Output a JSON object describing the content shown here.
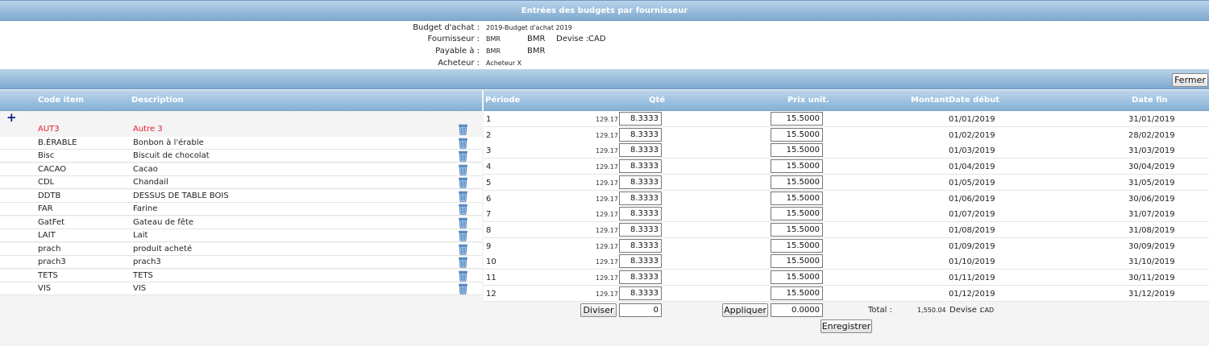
{
  "title": "Entrées des budgets par fournisseur",
  "header": {
    "budget_label": "Budget d'achat :",
    "budget_value": "2019-Budget d'achat 2019",
    "fournisseur_label": "Fournisseur :",
    "fournisseur_code": "BMR",
    "fournisseur_name": "BMR",
    "devise_label": "Devise :",
    "devise_value": "CAD",
    "payable_label": "Payable à :",
    "payable_code": "BMR",
    "payable_name": "BMR",
    "acheteur_label": "Acheteur :",
    "acheteur_value": "Acheteur X"
  },
  "buttons": {
    "fermer": "Fermer",
    "diviser": "Diviser",
    "appliquer": "Appliquer",
    "enregistrer": "Enregistrer"
  },
  "items_columns": {
    "code": "Code item",
    "description": "Description"
  },
  "items": [
    {
      "code": "AUT3",
      "description": "Autre 3",
      "selected": true
    },
    {
      "code": "B.ÉRABLE",
      "description": "Bonbon à l'érable"
    },
    {
      "code": "Bisc",
      "description": "Biscuit de chocolat"
    },
    {
      "code": "CACAO",
      "description": "Cacao"
    },
    {
      "code": "CDL",
      "description": "Chandail"
    },
    {
      "code": "DDTB",
      "description": "DESSUS DE TABLE BOIS"
    },
    {
      "code": "FAR",
      "description": "Farine"
    },
    {
      "code": "GatFet",
      "description": "Gateau de fête"
    },
    {
      "code": "LAIT",
      "description": "Lait"
    },
    {
      "code": "prach",
      "description": "produit acheté"
    },
    {
      "code": "prach3",
      "description": "prach3"
    },
    {
      "code": "TETS",
      "description": "TETS"
    },
    {
      "code": "VIS",
      "description": "VIS"
    }
  ],
  "periods_columns": {
    "periode": "Période",
    "qte": "Qté",
    "prix": "Prix unit.",
    "montant": "Montant",
    "date_debut": "Date début",
    "date_fin": "Date fin"
  },
  "periods": [
    {
      "periode": "1",
      "qte": "8.3333",
      "prix": "15.5000",
      "montant": "129.17",
      "debut": "01/01/2019",
      "fin": "31/01/2019"
    },
    {
      "periode": "2",
      "qte": "8.3333",
      "prix": "15.5000",
      "montant": "129.17",
      "debut": "01/02/2019",
      "fin": "28/02/2019"
    },
    {
      "periode": "3",
      "qte": "8.3333",
      "prix": "15.5000",
      "montant": "129.17",
      "debut": "01/03/2019",
      "fin": "31/03/2019"
    },
    {
      "periode": "4",
      "qte": "8.3333",
      "prix": "15.5000",
      "montant": "129.17",
      "debut": "01/04/2019",
      "fin": "30/04/2019"
    },
    {
      "periode": "5",
      "qte": "8.3333",
      "prix": "15.5000",
      "montant": "129.17",
      "debut": "01/05/2019",
      "fin": "31/05/2019"
    },
    {
      "periode": "6",
      "qte": "8.3333",
      "prix": "15.5000",
      "montant": "129.17",
      "debut": "01/06/2019",
      "fin": "30/06/2019"
    },
    {
      "periode": "7",
      "qte": "8.3333",
      "prix": "15.5000",
      "montant": "129.17",
      "debut": "01/07/2019",
      "fin": "31/07/2019"
    },
    {
      "periode": "8",
      "qte": "8.3333",
      "prix": "15.5000",
      "montant": "129.17",
      "debut": "01/08/2019",
      "fin": "31/08/2019"
    },
    {
      "periode": "9",
      "qte": "8.3333",
      "prix": "15.5000",
      "montant": "129.17",
      "debut": "01/09/2019",
      "fin": "30/09/2019"
    },
    {
      "periode": "10",
      "qte": "8.3333",
      "prix": "15.5000",
      "montant": "129.17",
      "debut": "01/10/2019",
      "fin": "31/10/2019"
    },
    {
      "periode": "11",
      "qte": "8.3333",
      "prix": "15.5000",
      "montant": "129.17",
      "debut": "01/11/2019",
      "fin": "30/11/2019"
    },
    {
      "periode": "12",
      "qte": "8.3333",
      "prix": "15.5000",
      "montant": "129.17",
      "debut": "01/12/2019",
      "fin": "31/12/2019"
    }
  ],
  "footer": {
    "diviser_value": "0",
    "appliquer_value": "0.0000",
    "total_label": "Total :",
    "total_value": "1,550.04",
    "devise_label": "Devise :",
    "devise_value": "CAD"
  },
  "icons": {
    "add": "plus-icon",
    "delete": "trash-icon"
  },
  "colors": {
    "header_blue": "#86b0d5",
    "selected_red": "#e5202b",
    "plus_blue": "#0c1f8f"
  }
}
